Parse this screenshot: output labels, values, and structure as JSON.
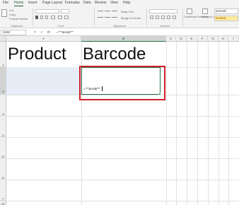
{
  "ribbon": {
    "tabs": [
      "File",
      "Home",
      "Insert",
      "Page Layout",
      "Formulas",
      "Data",
      "Review",
      "View",
      "Help"
    ],
    "active_tab": "Home",
    "clipboard": {
      "cut": "Cut",
      "copy": "Copy",
      "format_painter": "Format Painter",
      "label": "Clipboard"
    },
    "font_label": "Font",
    "alignment": {
      "wrap_text": "Wrap Text",
      "merge_center": "Merge & Center",
      "label": "Alignment"
    },
    "number_label": "Number",
    "styles": {
      "conditional_formatting": "Conditional Formatting",
      "format_as_table": "Format as Table",
      "normal": "Normal",
      "neutral": "Neutral"
    }
  },
  "formula_bar": {
    "name_box": "SUM",
    "cancel": "×",
    "enter": "✓",
    "fx": "fx",
    "content": "=\"*\"&A2&\"*\""
  },
  "grid": {
    "columns": [
      "A",
      "B",
      "C",
      "D",
      "E",
      "F",
      "G",
      "H",
      "I"
    ],
    "rows": [
      "1",
      "2",
      "3",
      "4",
      "5",
      "6",
      "7",
      "8"
    ],
    "selected_column": "B",
    "selected_row": "2"
  },
  "cells": {
    "A1": "Product",
    "B1": "Barcode",
    "A2": "",
    "B2": "=\"*\"&A2&\"*\""
  },
  "colors": {
    "accent": "#217346",
    "highlight": "#d0202a",
    "selection_fill": "#e6edf7"
  }
}
